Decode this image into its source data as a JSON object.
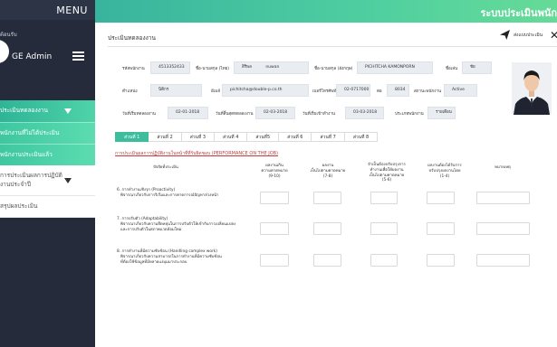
{
  "sidebar": {
    "menu_title": "MENU",
    "welcome_text": "ต้อนรับ",
    "user_name": "GE Admin",
    "nav": [
      {
        "label": "ประเมินทดลองงาน"
      },
      {
        "label": "พนักงานที่ไม่ได้ประเมิน"
      },
      {
        "label": "พนักงานประเมินแล้ว"
      },
      {
        "label": "การประเมินผลการปฏิบัติงานประจำปี"
      },
      {
        "label": "สรุปผลประเมิน"
      }
    ]
  },
  "header": {
    "app_title": "ระบบประเมินพนัก"
  },
  "main": {
    "section_title": "ประเมินทดลองงาน",
    "send_label": "ส่งแบบประเมิน",
    "fields": {
      "employee_id": {
        "label": "รหัสพนักงาน",
        "value": "4513352433"
      },
      "first_name_th": {
        "label": "ชื่อ-นามสกุล (ไทย)",
        "prefix": "สิริพล",
        "value": "nuwan"
      },
      "name_en": {
        "label": "ชื่อ-นามสกุล (อังกฤษ)",
        "value": "PICHITCHA   KAMONPORN"
      },
      "nickname": {
        "label": "ชื่อเล่น",
        "value": "ชัย"
      },
      "position": {
        "label": "ตำแหน่ง",
        "value": "นิติกร"
      },
      "email": {
        "label": "อีเมล์",
        "value": "pichitcha@double-p.co.th"
      },
      "phone": {
        "label": "เบอร์โทรศัพท์",
        "value": "02-0717000"
      },
      "ext": {
        "label": "ต่อ",
        "value": "8034"
      },
      "status": {
        "label": "สถานะพนักงาน",
        "value": "Active"
      },
      "probation_start": {
        "label": "วันที่เริ่มทดลองงาน",
        "value": "02-01-2018"
      },
      "probation_end": {
        "label": "วันที่สิ้นสุดทดลองงาน",
        "value": "02-03-2018"
      },
      "start_date": {
        "label": "วันที่เริ่มเข้าทำงาน",
        "value": "03-03-2018"
      },
      "emp_type": {
        "label": "ประเภทพนักงาน",
        "value": "รายเดือน"
      }
    },
    "tabs": [
      "ส่วนที่ 1",
      "ส่วนที่ 2",
      "ส่วนที่ 3",
      "ส่วนที่ 4",
      "ส่วนที่5",
      "ส่วนที่ 6",
      "ส่วนที่ 7",
      "ส่วนที่ 8"
    ],
    "perf_link": "การประเมินผลการปฏิบัติงานในหน้าที่ที่รับผิดชอบ (PERFORMANCE ON THE JOB)",
    "columns": {
      "criteria": "ปัจจัยที่ประเมิน",
      "c1": "ผลงานเกิน\nความคาดหมาย\n(9-10)",
      "c2": "ผลงาน\nเป็นไปตามคาดหมาย\n(7-8)",
      "c3": "จำเป็นต้องปรับปรุงการ\nทำงานเพื่อให้ผลงาน\nเป็นไปตามคาดหมาย\n(5-6)",
      "c4": "ผลงานต้องได้รับการ\nปรับปรุงผลงานโดย\n(1-4)",
      "c5": "หมายเหตุ"
    },
    "criteria": [
      {
        "title": "6. การทำงานเชิงรุก (Proactivity)",
        "desc": "พิจารณาเกี่ยวกับการริเริ่มและการคาดการณ์ปัญหาล่วงหน้า"
      },
      {
        "title": "7. การปรับตัว (Adaptability)",
        "desc": "พิจารณาเกี่ยวกับความยืดหยุ่นในการปรับตัวให้เข้ากับการเปลี่ยนแปลง\nและการปรับตัวในสภาพแวดล้อมใหม่"
      },
      {
        "title": "8. การทำงานที่มีความซับซ้อน (Handling complex work)",
        "desc": "พิจารณาเกี่ยวกับความสามารถในการทำงานที่มีความซับซ้อน\nที่ต้องใช้ข้อมูลที่มีหลายแง่มุมมาประกอบ"
      }
    ]
  }
}
